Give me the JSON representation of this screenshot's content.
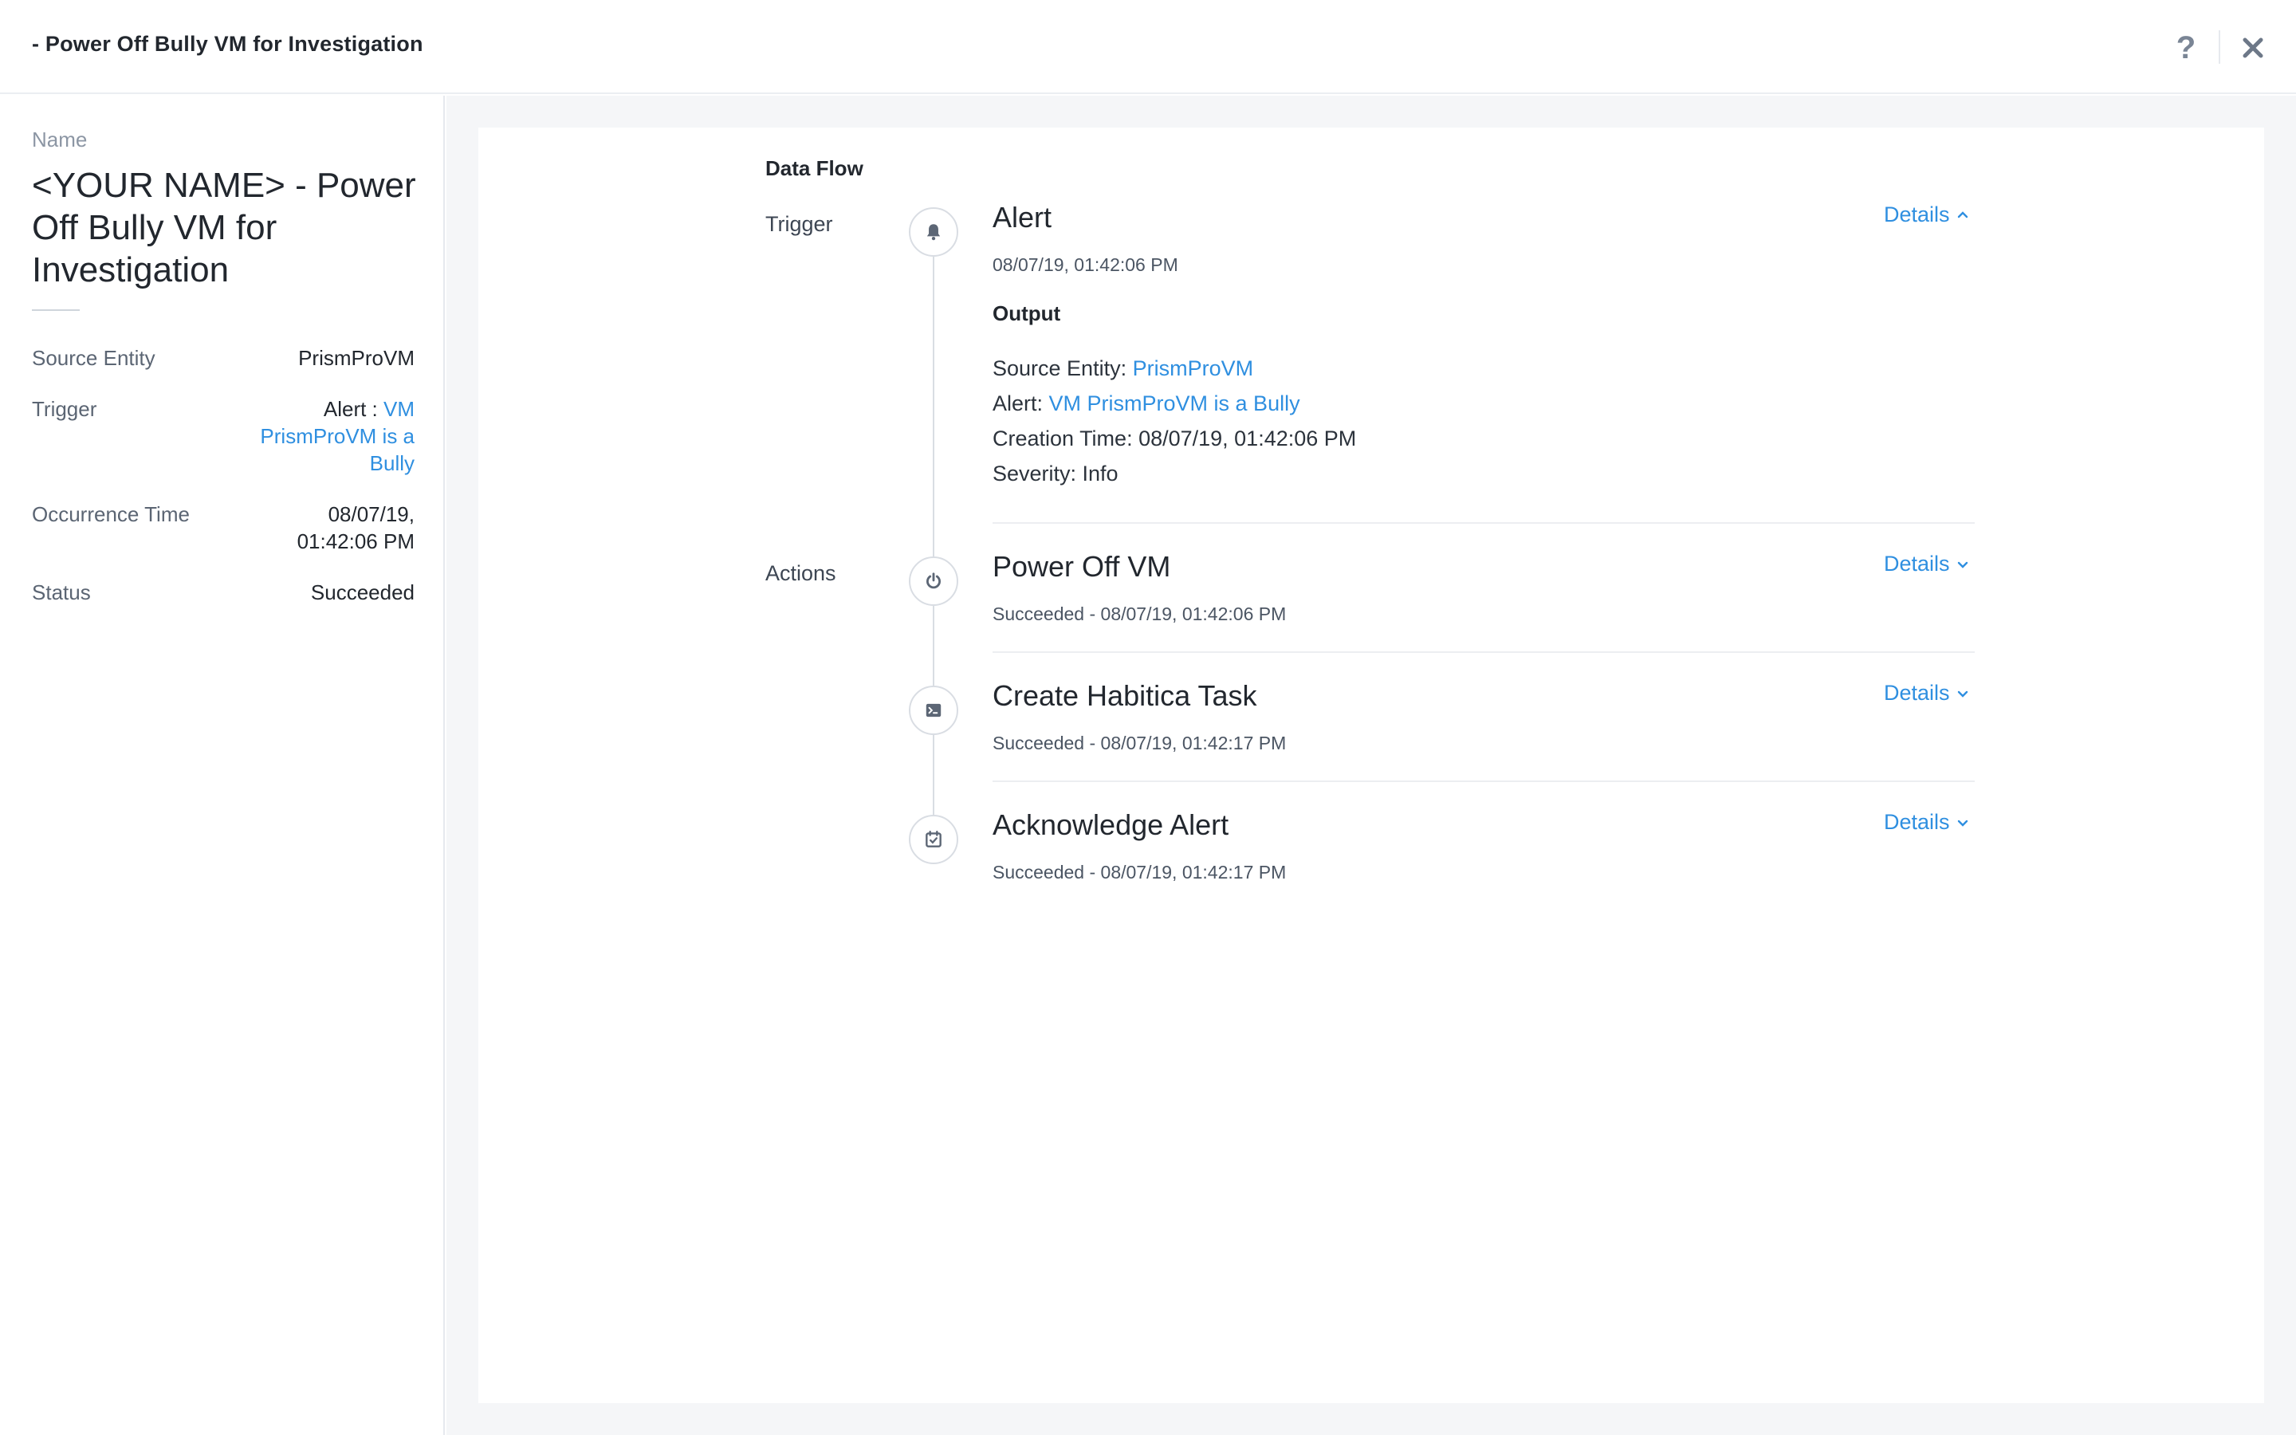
{
  "header": {
    "title": "- Power Off Bully VM for Investigation",
    "help_icon": "question-icon",
    "close_icon": "close-icon"
  },
  "sidebar": {
    "name_label": "Name",
    "name_value": "<YOUR NAME> - Power Off Bully VM for Investigation",
    "source_entity_label": "Source Entity",
    "source_entity_value": "PrismProVM",
    "trigger_label": "Trigger",
    "trigger_prefix": "Alert : ",
    "trigger_link": "VM PrismProVM is a Bully",
    "occurrence_label": "Occurrence Time",
    "occurrence_value": "08/07/19, 01:42:06 PM",
    "status_label": "Status",
    "status_value": "Succeeded"
  },
  "flow": {
    "title": "Data Flow",
    "trigger_section": "Trigger",
    "actions_section": "Actions",
    "trigger": {
      "icon": "bell-icon",
      "title": "Alert",
      "timestamp": "08/07/19, 01:42:06 PM",
      "details_label": "Details",
      "output_title": "Output",
      "output": {
        "source_entity_label": "Source Entity: ",
        "source_entity_value": "PrismProVM",
        "alert_label": "Alert: ",
        "alert_value": "VM PrismProVM is a Bully",
        "creation_time": "Creation Time: 08/07/19, 01:42:06 PM",
        "severity": "Severity: Info"
      }
    },
    "actions": [
      {
        "icon": "power-icon",
        "title": "Power Off VM",
        "status": "Succeeded - 08/07/19, 01:42:06 PM",
        "details_label": "Details"
      },
      {
        "icon": "terminal-icon",
        "title": "Create Habitica Task",
        "status": "Succeeded - 08/07/19, 01:42:17 PM",
        "details_label": "Details"
      },
      {
        "icon": "calendar-check-icon",
        "title": "Acknowledge Alert",
        "status": "Succeeded - 08/07/19, 01:42:17 PM",
        "details_label": "Details"
      }
    ]
  },
  "colors": {
    "link": "#2f8fe0",
    "text": "#22272e",
    "muted": "#8c96a4",
    "page_bg": "#f5f6f8"
  }
}
